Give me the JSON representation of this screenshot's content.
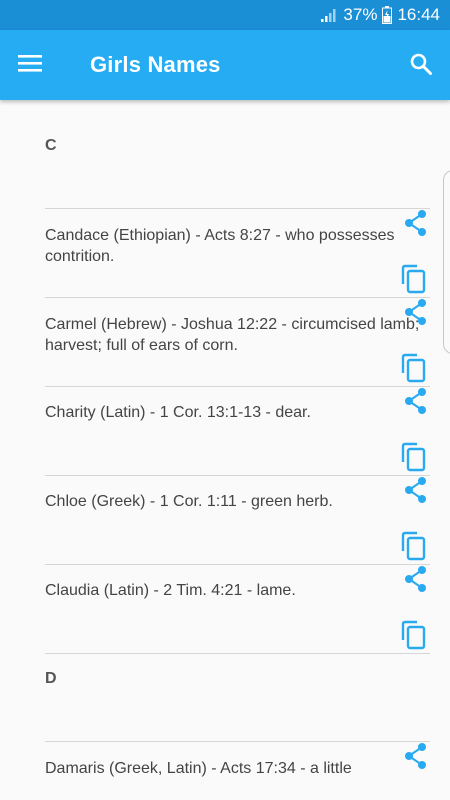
{
  "status_bar": {
    "battery_percent": "37%",
    "time": "16:44"
  },
  "app_bar": {
    "title": "Girls Names",
    "menu_icon": "hamburger-menu-icon",
    "search_icon": "search-icon"
  },
  "sections": [
    {
      "letter": "C",
      "entries": [
        {
          "text": "Candace (Ethiopian) - Acts 8:27 - who possesses contrition."
        },
        {
          "text": "Carmel (Hebrew) - Joshua 12:22 - circumcised lamb; harvest; full of ears of corn."
        },
        {
          "text": "Charity (Latin) - 1 Cor. 13:1-13 - dear."
        },
        {
          "text": "Chloe (Greek) - 1 Cor. 1:11 - green herb."
        },
        {
          "text": "Claudia (Latin) - 2 Tim. 4:21 - lame."
        }
      ]
    },
    {
      "letter": "D",
      "entries": [
        {
          "text": "Damaris (Greek, Latin) - Acts 17:34 - a little"
        }
      ]
    }
  ],
  "colors": {
    "status_bar": "#1a8fd6",
    "app_bar": "#25acf2",
    "accent_icon": "#29a9f0"
  }
}
